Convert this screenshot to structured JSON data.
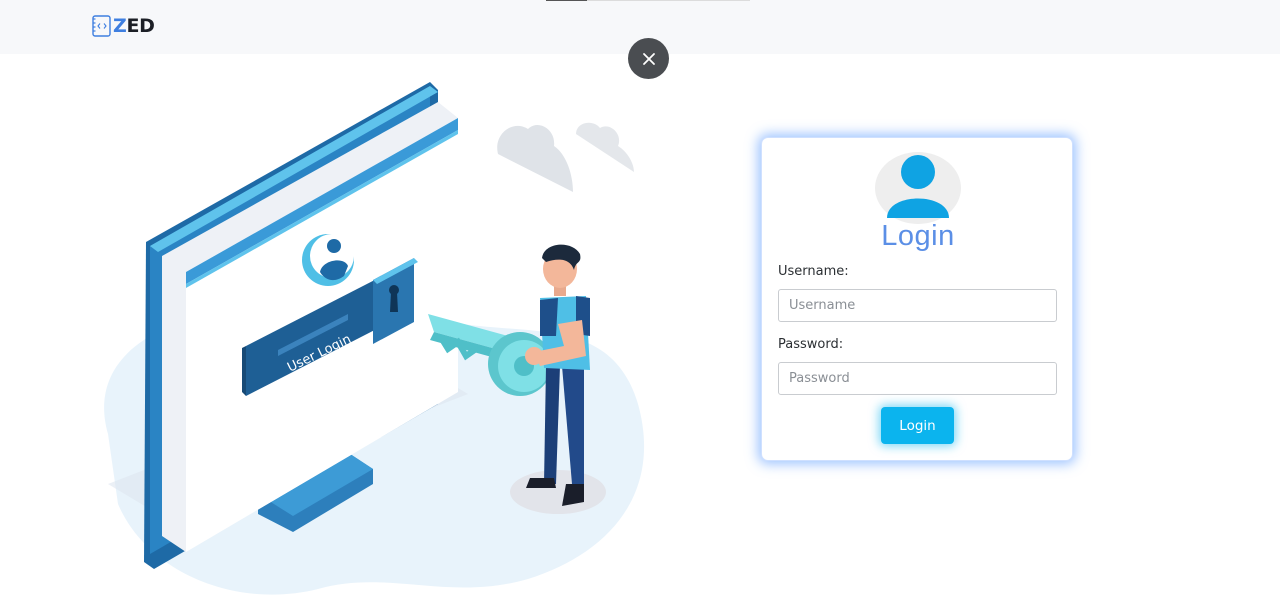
{
  "brand": {
    "name_prefix": "Z",
    "name_rest": "ED"
  },
  "illustration": {
    "screen_caption": "User Login"
  },
  "login_form": {
    "title": "Login",
    "username_label": "Username:",
    "username_placeholder": "Username",
    "password_label": "Password:",
    "password_placeholder": "Password",
    "submit_label": "Login"
  },
  "colors": {
    "accent": "#0bb4ee",
    "title": "#5b8fe6",
    "close_bg": "#4a4d51"
  }
}
